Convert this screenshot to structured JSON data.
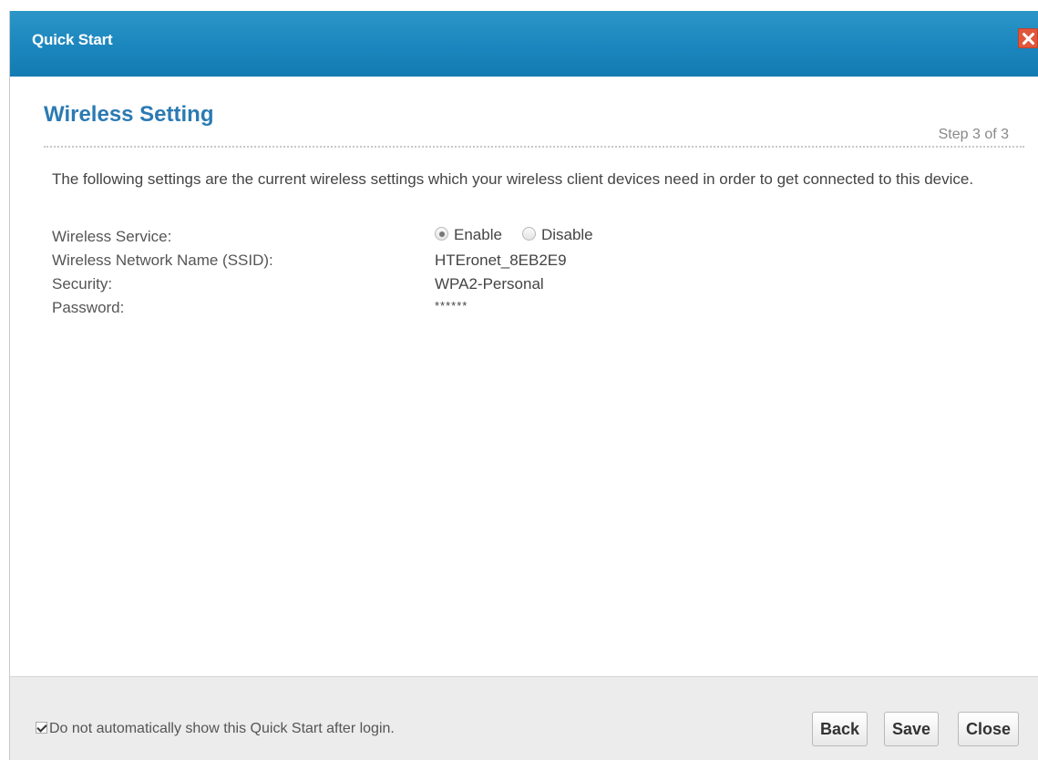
{
  "window": {
    "title": "Quick Start",
    "close_icon": "close-icon"
  },
  "content": {
    "heading": "Wireless Setting",
    "step": "Step 3 of 3",
    "intro": "The following settings are the current wireless settings which your wireless client devices need in order to get connected to this device.",
    "fields": {
      "service_label": "Wireless Service:",
      "service_options": [
        "Enable",
        "Disable"
      ],
      "service_selected": "Enable",
      "ssid_label": "Wireless Network Name (SSID):",
      "ssid_value": "HTEronet_8EB2E9",
      "security_label": "Security:",
      "security_value": "WPA2-Personal",
      "password_label": "Password:",
      "password_value": "******"
    }
  },
  "footer": {
    "checkbox_label": "Do not automatically show this Quick Start after login.",
    "checkbox_checked": true,
    "buttons": {
      "back": "Back",
      "save": "Save",
      "close": "Close"
    }
  },
  "colors": {
    "titlebar": "#1b86bd",
    "heading": "#2b7ab3",
    "close_button": "#e0573c"
  }
}
